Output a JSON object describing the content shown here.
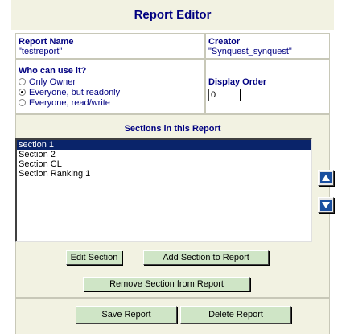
{
  "title": "Report Editor",
  "report_name": {
    "label": "Report Name",
    "value": "\"testreport\""
  },
  "creator": {
    "label": "Creator",
    "value": "\"Synquest_synquest\""
  },
  "permissions": {
    "label": "Who can use it?",
    "options": [
      "Only Owner",
      "Everyone, but readonly",
      "Everyone, read/write"
    ],
    "selected_index": 1
  },
  "display_order": {
    "label": "Display Order",
    "value": "0"
  },
  "sections": {
    "header": "Sections in this Report",
    "items": [
      "section 1",
      "Section 2",
      "Section CL",
      "Section Ranking 1"
    ],
    "selected_index": 0
  },
  "buttons": {
    "edit_section": "Edit Section",
    "add_section": "Add Section to Report",
    "remove_section": "Remove Section from Report",
    "save_report": "Save Report",
    "delete_report": "Delete Report"
  },
  "colors": {
    "header_text": "#000080",
    "button_bg": "#cfe5c6",
    "panel_bg": "#f2f2e2",
    "selection": "#0a246a"
  }
}
